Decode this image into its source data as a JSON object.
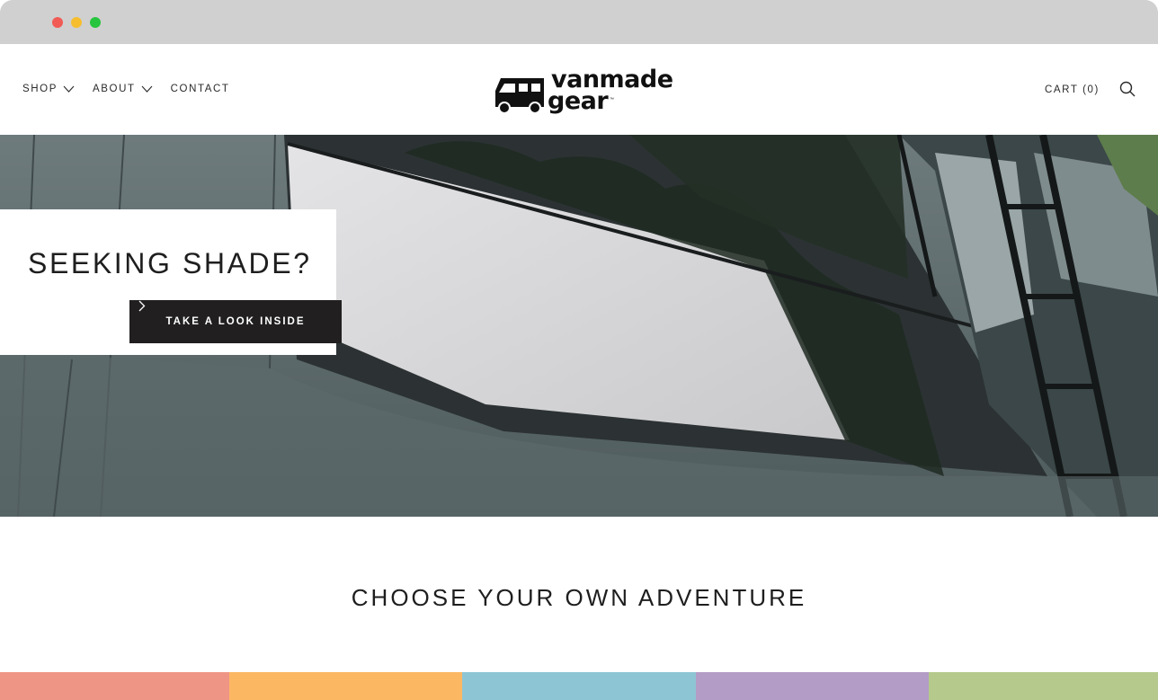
{
  "browser": {
    "dots": [
      "red",
      "yellow",
      "green"
    ]
  },
  "header": {
    "nav": [
      {
        "label": "SHOP",
        "has_dropdown": true
      },
      {
        "label": "ABOUT",
        "has_dropdown": true
      },
      {
        "label": "CONTACT",
        "has_dropdown": false
      }
    ],
    "logo": {
      "line1": "vanmade",
      "line2": "gear",
      "tm": "™",
      "icon": "van-icon"
    },
    "cart_label": "CART (0)",
    "search_icon": "search-icon"
  },
  "hero": {
    "title": "SEEKING SHADE?",
    "button_label": "TAKE A LOOK INSIDE",
    "button_icon": "chevron-right-icon"
  },
  "section": {
    "title": "CHOOSE YOUR OWN ADVENTURE"
  },
  "color_stripes": [
    "#ef9585",
    "#fcb763",
    "#8ec5d5",
    "#b39cc5",
    "#b5c98c"
  ],
  "colors": {
    "button_bg": "#211f20",
    "text": "#1e1e1e"
  }
}
